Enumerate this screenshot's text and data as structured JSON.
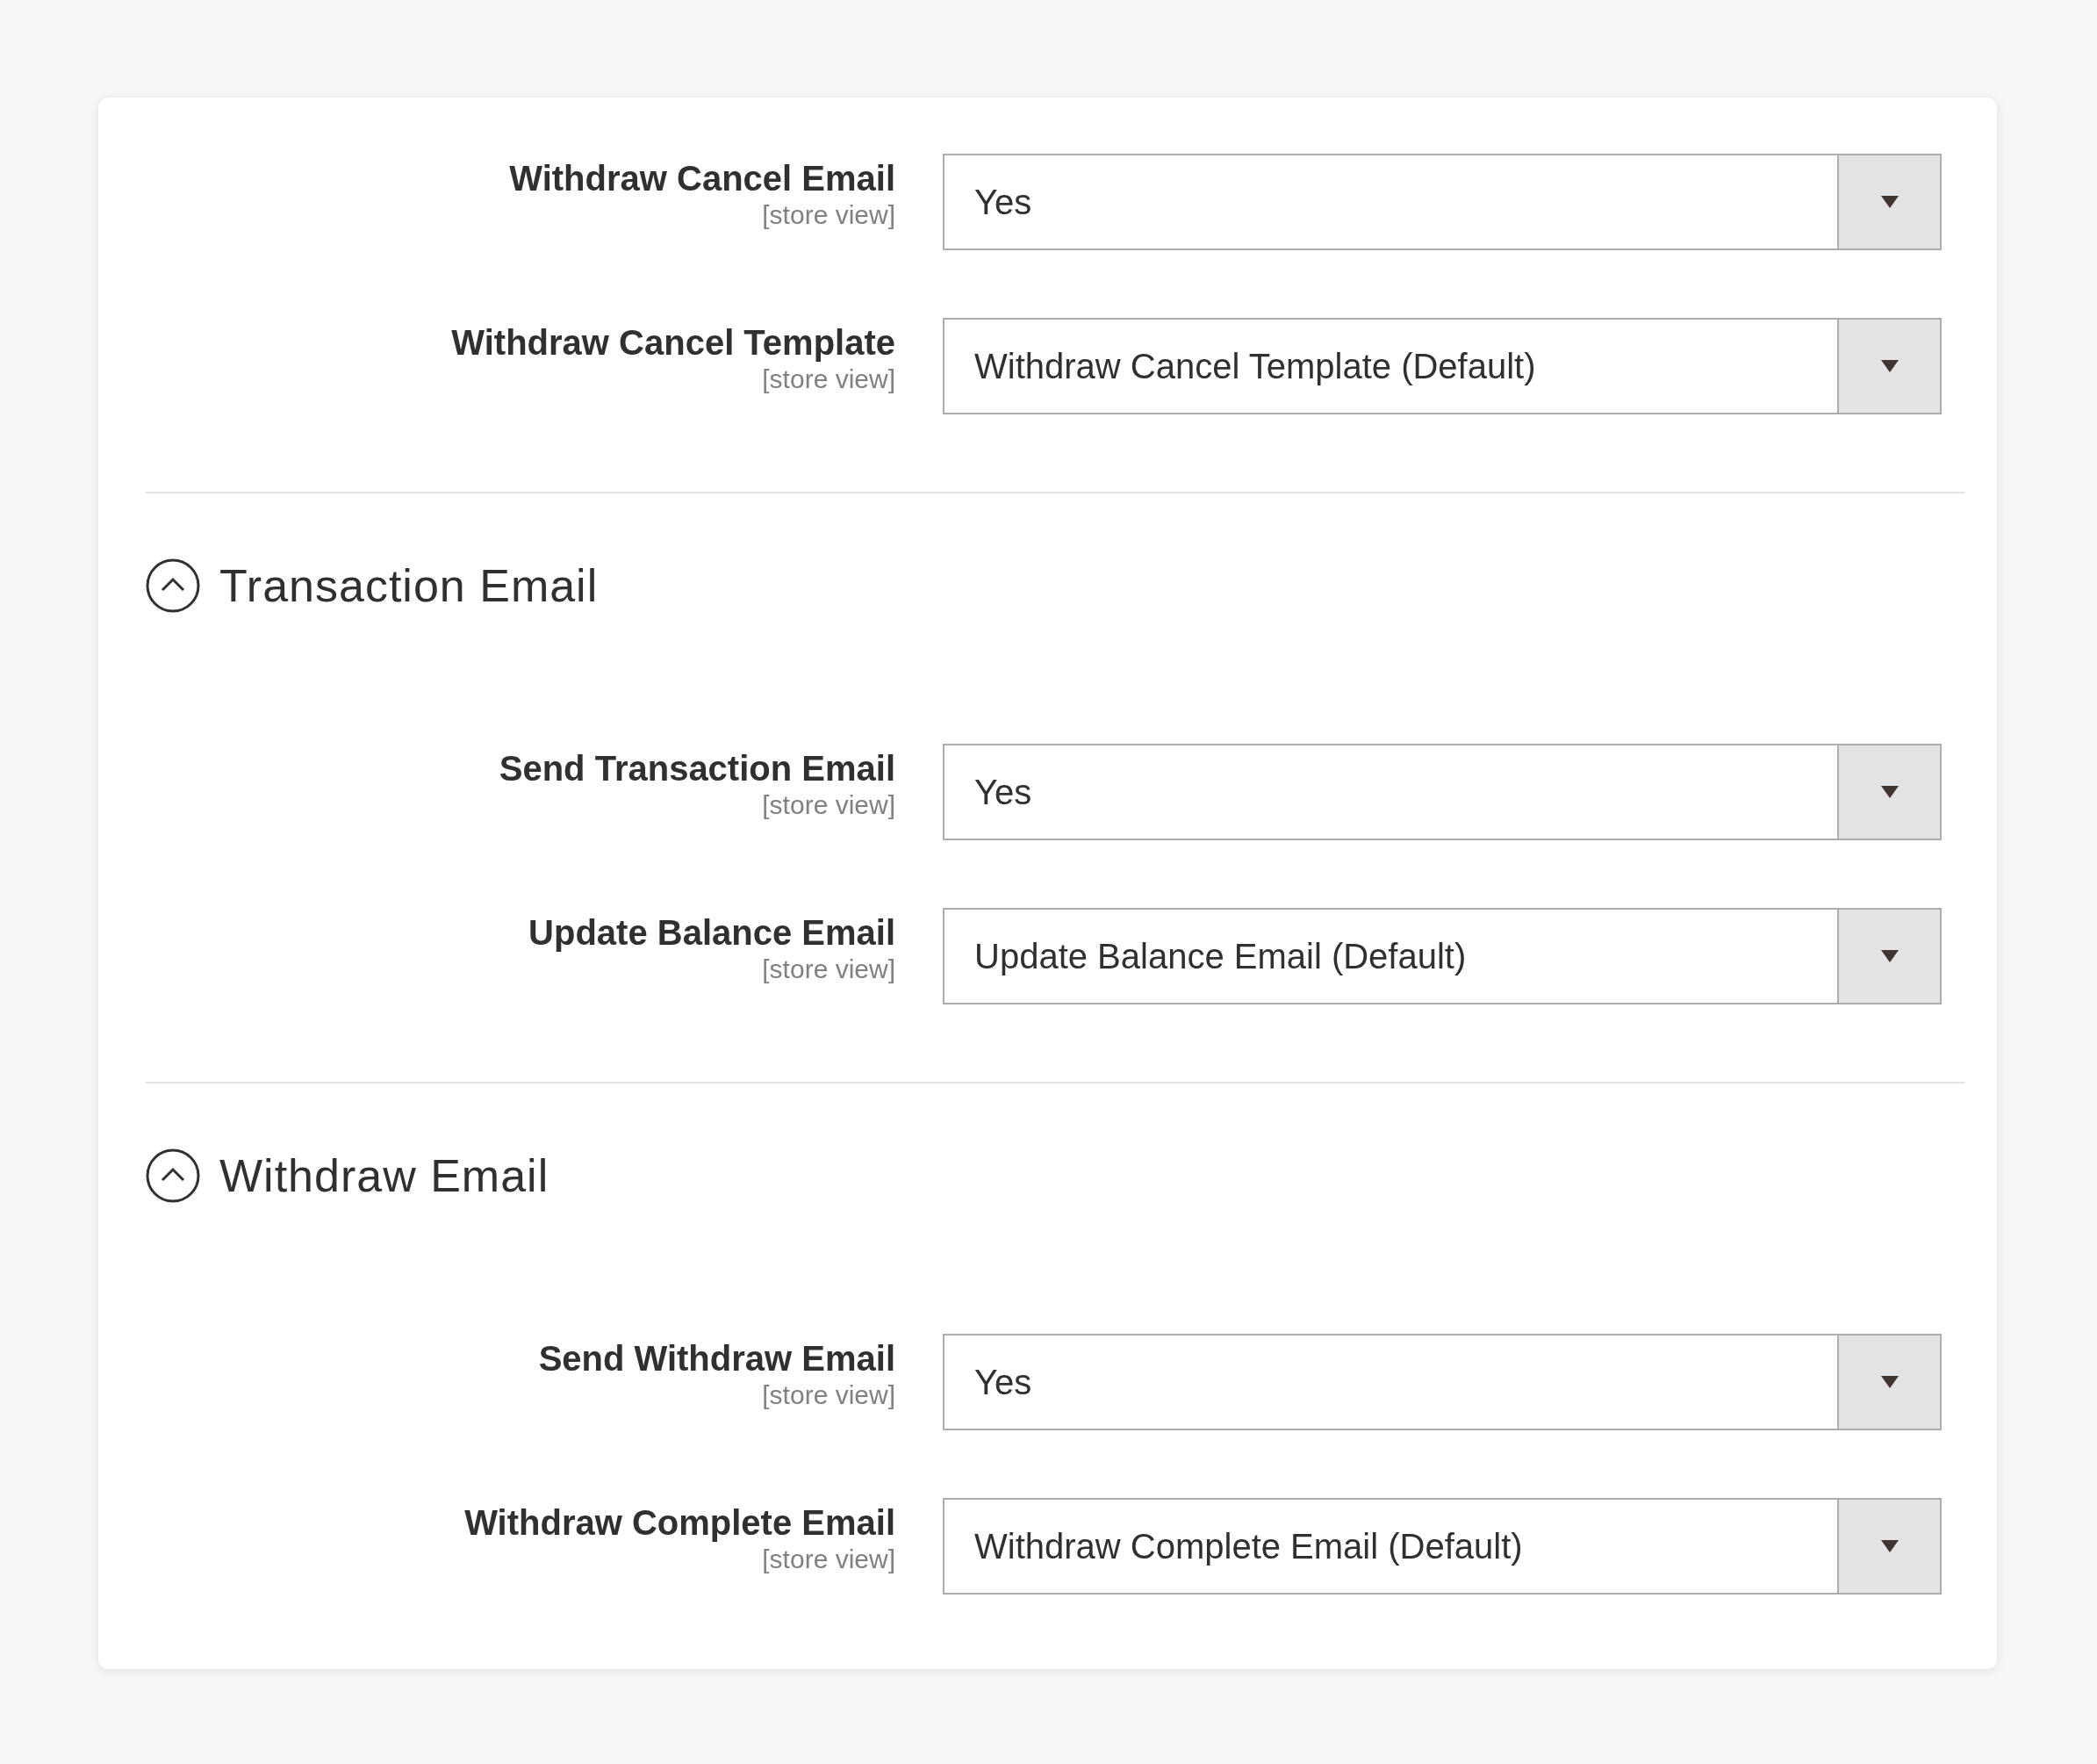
{
  "sections": [
    {
      "fields": [
        {
          "label": "Withdraw Cancel Email",
          "scope": "[store view]",
          "value": "Yes"
        },
        {
          "label": "Withdraw Cancel Template",
          "scope": "[store view]",
          "value": "Withdraw Cancel Template (Default)"
        }
      ]
    },
    {
      "title": "Transaction Email",
      "expanded": true,
      "fields": [
        {
          "label": "Send Transaction Email",
          "scope": "[store view]",
          "value": "Yes"
        },
        {
          "label": "Update Balance Email",
          "scope": "[store view]",
          "value": "Update Balance Email (Default)"
        }
      ]
    },
    {
      "title": "Withdraw Email",
      "expanded": true,
      "fields": [
        {
          "label": "Send Withdraw Email",
          "scope": "[store view]",
          "value": "Yes"
        },
        {
          "label": "Withdraw Complete Email",
          "scope": "[store view]",
          "value": "Withdraw Complete Email (Default)"
        }
      ]
    }
  ]
}
